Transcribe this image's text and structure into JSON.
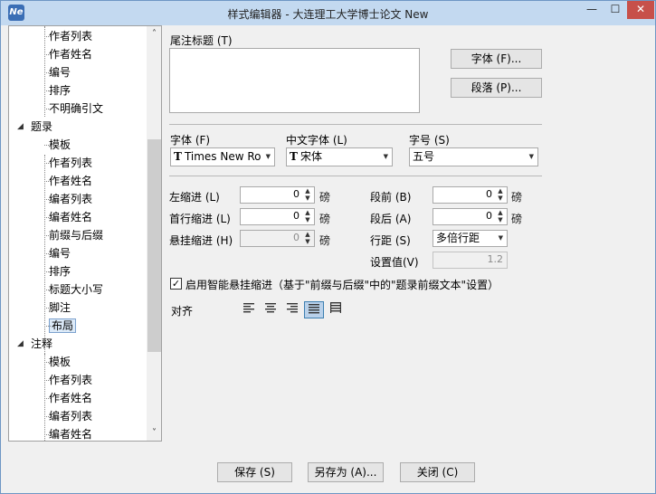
{
  "window": {
    "title": "样式编辑器 - 大连理工大学博士论文 New",
    "app_icon_text": "Ne"
  },
  "title_buttons": {
    "minimize": "—",
    "maximize": "☐",
    "close": "✕"
  },
  "tree": {
    "items": [
      {
        "label": "作者列表",
        "level": "child"
      },
      {
        "label": "作者姓名",
        "level": "child"
      },
      {
        "label": "编号",
        "level": "child"
      },
      {
        "label": "排序",
        "level": "child"
      },
      {
        "label": "不明确引文",
        "level": "child"
      },
      {
        "label": "题录",
        "level": "group"
      },
      {
        "label": "模板",
        "level": "child"
      },
      {
        "label": "作者列表",
        "level": "child"
      },
      {
        "label": "作者姓名",
        "level": "child"
      },
      {
        "label": "编者列表",
        "level": "child"
      },
      {
        "label": "编者姓名",
        "level": "child"
      },
      {
        "label": "前缀与后缀",
        "level": "child"
      },
      {
        "label": "编号",
        "level": "child"
      },
      {
        "label": "排序",
        "level": "child"
      },
      {
        "label": "标题大小写",
        "level": "child"
      },
      {
        "label": "脚注",
        "level": "child"
      },
      {
        "label": "布局",
        "level": "child",
        "selected": true
      },
      {
        "label": "注释",
        "level": "group"
      },
      {
        "label": "模板",
        "level": "child"
      },
      {
        "label": "作者列表",
        "level": "child"
      },
      {
        "label": "作者姓名",
        "level": "child"
      },
      {
        "label": "编者列表",
        "level": "child"
      },
      {
        "label": "编者姓名",
        "level": "child"
      }
    ],
    "expander_glyph": "◢"
  },
  "endnote_title": {
    "label": "尾注标题 (T)",
    "font_button": "字体 (F)...",
    "paragraph_button": "段落 (P)..."
  },
  "font_row": {
    "font_label": "字体 (F)",
    "font_value": "Times New Ro",
    "cn_font_label": "中文字体 (L)",
    "cn_font_value": "宋体",
    "size_label": "字号 (S)",
    "size_value": "五号",
    "tt_icon": "T"
  },
  "indent": {
    "left_label": "左缩进 (L)",
    "left_value": "0",
    "first_label": "首行缩进 (L)",
    "first_value": "0",
    "hanging_label": "悬挂缩进 (H)",
    "hanging_value": "0",
    "unit": "磅"
  },
  "spacing": {
    "before_label": "段前 (B)",
    "before_value": "0",
    "after_label": "段后 (A)",
    "after_value": "0",
    "line_label": "行距 (S)",
    "line_value": "多倍行距",
    "setting_label": "设置值(V)",
    "setting_value": "1.2",
    "unit": "磅"
  },
  "smart_hanging": {
    "checked": true,
    "check_glyph": "✓",
    "label": "启用智能悬挂缩进（基于\"前缀与后缀\"中的\"题录前缀文本\"设置）"
  },
  "alignment": {
    "label": "对齐",
    "options": [
      "left",
      "center",
      "right",
      "justify",
      "distributed"
    ],
    "active": "justify"
  },
  "footer": {
    "save": "保存 (S)",
    "save_as": "另存为 (A)...",
    "close": "关闭 (C)"
  }
}
